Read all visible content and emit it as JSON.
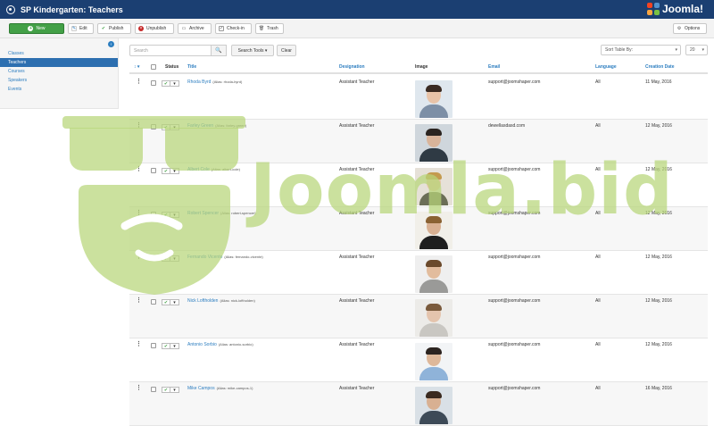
{
  "header": {
    "title": "SP Kindergarten: Teachers",
    "brand": "Joomla!"
  },
  "toolbar": {
    "new": "New",
    "edit": "Edit",
    "publish": "Publish",
    "unpublish": "Unpublish",
    "archive": "Archive",
    "checkin": "Check-in",
    "trash": "Trash",
    "options": "Options"
  },
  "sidebar": {
    "items": [
      {
        "label": "Classes"
      },
      {
        "label": "Teachers"
      },
      {
        "label": "Courses"
      },
      {
        "label": "Speakers"
      },
      {
        "label": "Events"
      }
    ]
  },
  "filters": {
    "search_placeholder": "Search",
    "search_tools": "Search Tools ▾",
    "clear": "Clear",
    "sort_placeholder": "Sort Table By:",
    "limit": "20"
  },
  "columns": {
    "order": "↕ ▾",
    "status": "Status",
    "title": "Title",
    "designation": "Designation",
    "image": "Image",
    "email": "Email",
    "language": "Language",
    "created": "Creation Date"
  },
  "rows": [
    {
      "title": "Rhoda Byrd",
      "alias": "(Alias: rhoda-byrd)",
      "designation": "Assistant Teacher",
      "email": "support@joomshaper.com",
      "language": "All",
      "date": "11 May, 2016",
      "photo": "woman"
    },
    {
      "title": "Farley Green",
      "alias": "(Alias: farley-green)",
      "designation": "Assistant Teacher",
      "email": "dewellasdasd.com",
      "language": "All",
      "date": "12 May, 2016",
      "photo": "man-dark"
    },
    {
      "title": "Albert Cole",
      "alias": "(Alias: albert-cole)",
      "designation": "Assistant Teacher",
      "email": "support@joomshaper.com",
      "language": "All",
      "date": "12 May, 2016",
      "photo": "woman-blonde"
    },
    {
      "title": "Robert Spencer",
      "alias": "(Alias: robert-spencer)",
      "designation": "Assistant Teacher",
      "email": "support@joomshaper.com",
      "language": "All",
      "date": "12 May, 2016",
      "photo": "man-beard"
    },
    {
      "title": "Fernando Vicente",
      "alias": "(Alias: fernando-vicente)",
      "designation": "Assistant Teacher",
      "email": "support@joomshaper.com",
      "language": "All",
      "date": "12 May, 2016",
      "photo": "man-curly"
    },
    {
      "title": "Nick Loftholden",
      "alias": "(Alias: nick-loftholden)",
      "designation": "Assistant Teacher",
      "email": "support@joomshaper.com",
      "language": "All",
      "date": "12 May, 2016",
      "photo": "woman-2"
    },
    {
      "title": "Antonio Sorbio",
      "alias": "(Alias: antonio-sorbio)",
      "designation": "Assistant Teacher",
      "email": "support@joomshaper.com",
      "language": "All",
      "date": "12 May, 2016",
      "photo": "man-shirt"
    },
    {
      "title": "Mike Campos",
      "alias": "(Alias: mike-campos-1)",
      "designation": "Assistant Teacher",
      "email": "support@joomshaper.com",
      "language": "All",
      "date": "16 May, 2016",
      "photo": "man-smile"
    }
  ],
  "watermark": {
    "text": "Joomla.bid"
  },
  "colors": {
    "header": "#1b3f72",
    "accent": "#2d7ec0",
    "new_button": "#43a047",
    "watermark": "#b7d678"
  }
}
